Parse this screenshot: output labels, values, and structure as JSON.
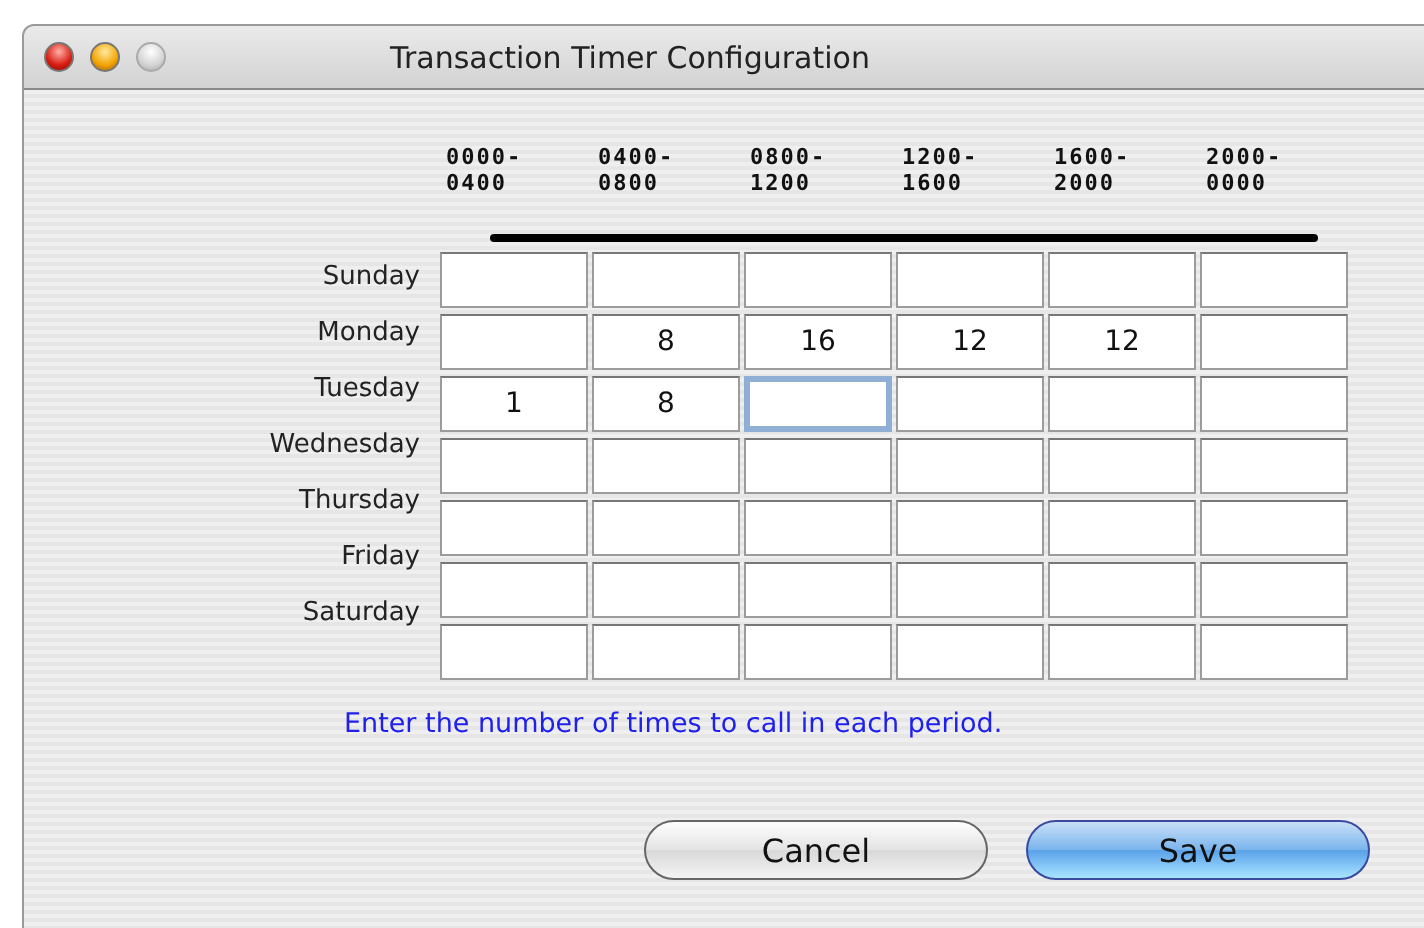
{
  "window": {
    "title": "Transaction Timer Configuration",
    "controls": [
      {
        "kind": "close",
        "disabled": false
      },
      {
        "kind": "minimize",
        "disabled": false
      },
      {
        "kind": "zoom",
        "disabled": true
      }
    ]
  },
  "columns": [
    "0000-\n0400",
    "0400-\n0800",
    "0800-\n1200",
    "1200-\n1600",
    "1600-\n2000",
    "2000-\n0000"
  ],
  "rows": [
    {
      "day": "Sunday",
      "cells": [
        {
          "focused": false
        },
        {
          "focused": false
        },
        {
          "focused": false
        },
        {
          "focused": false
        },
        {
          "focused": false
        },
        {
          "focused": false
        }
      ]
    },
    {
      "day": "Monday",
      "cells": [
        {
          "focused": false
        },
        {
          "value": "8",
          "focused": false
        },
        {
          "value": "16",
          "focused": false
        },
        {
          "value": "12",
          "focused": false
        },
        {
          "value": "12",
          "focused": false
        },
        {
          "focused": false
        }
      ]
    },
    {
      "day": "Tuesday",
      "cells": [
        {
          "value": "1",
          "focused": false
        },
        {
          "value": "8",
          "focused": false
        },
        {
          "focused": true
        },
        {
          "focused": false
        },
        {
          "focused": false
        },
        {
          "focused": false
        }
      ]
    },
    {
      "day": "Wednesday",
      "cells": [
        {
          "focused": false
        },
        {
          "focused": false
        },
        {
          "focused": false
        },
        {
          "focused": false
        },
        {
          "focused": false
        },
        {
          "focused": false
        }
      ]
    },
    {
      "day": "Thursday",
      "cells": [
        {
          "focused": false
        },
        {
          "focused": false
        },
        {
          "focused": false
        },
        {
          "focused": false
        },
        {
          "focused": false
        },
        {
          "focused": false
        }
      ]
    },
    {
      "day": "Friday",
      "cells": [
        {
          "focused": false
        },
        {
          "focused": false
        },
        {
          "focused": false
        },
        {
          "focused": false
        },
        {
          "focused": false
        },
        {
          "focused": false
        }
      ]
    },
    {
      "day": "Saturday",
      "cells": [
        {
          "focused": false
        },
        {
          "focused": false
        },
        {
          "focused": false
        },
        {
          "focused": false
        },
        {
          "focused": false
        },
        {
          "focused": false
        }
      ]
    }
  ],
  "hint": "Enter the number of times to call in each period.",
  "buttons": [
    {
      "label": "Cancel",
      "default": false
    },
    {
      "label": "Save",
      "default": true
    }
  ]
}
